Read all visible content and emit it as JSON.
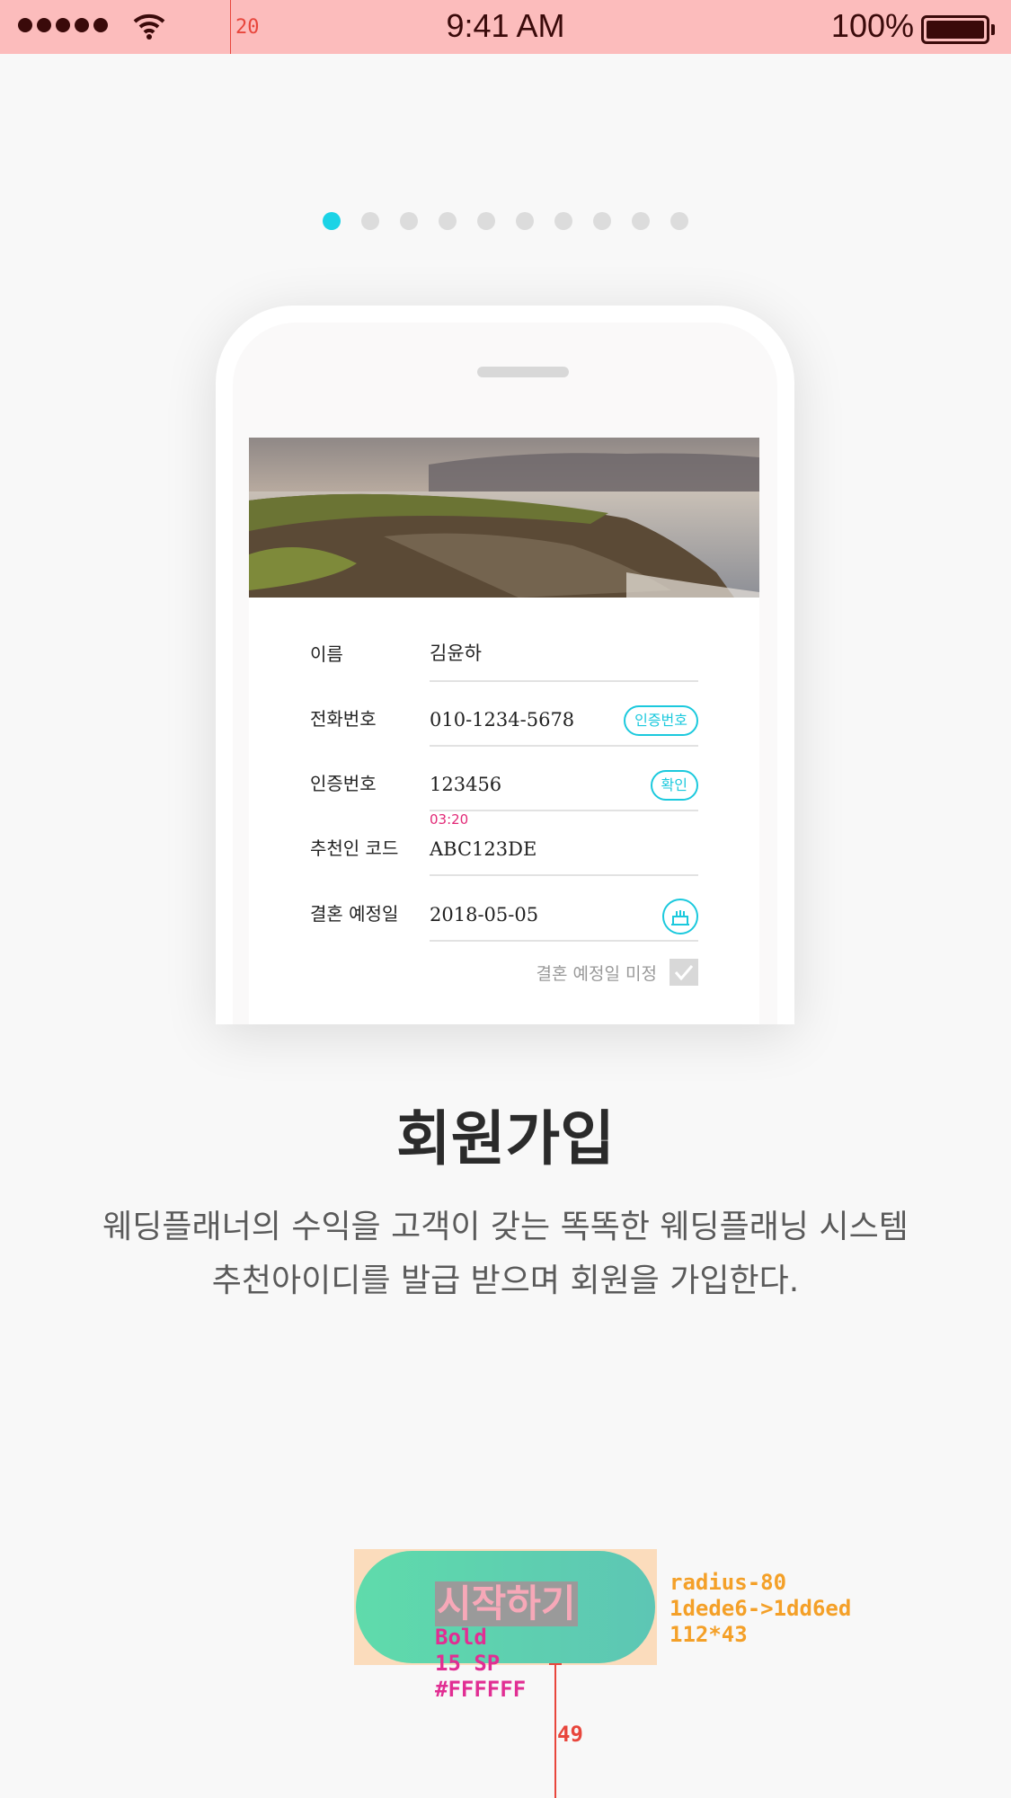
{
  "status_bar": {
    "time": "9:41 AM",
    "battery": "100%",
    "guide_label": "20"
  },
  "pagination": {
    "total": 10,
    "active_index": 0,
    "active_color": "#1bd3e6"
  },
  "form": {
    "name": {
      "label": "이름",
      "value": "김윤하"
    },
    "phone": {
      "label": "전화번호",
      "value": "010-1234-5678",
      "button": "인증번호"
    },
    "verification": {
      "label": "인증번호",
      "value": "123456",
      "button": "확인",
      "timer": "03:20"
    },
    "referral": {
      "label": "추천인 코드",
      "value": "ABC123DE"
    },
    "wedding_date": {
      "label": "결혼 예정일",
      "value": "2018-05-05",
      "icon": "cake-icon"
    },
    "undecided": {
      "label": "결혼 예정일 미정",
      "checked": true
    }
  },
  "title": "회원가입",
  "description": [
    "웨딩플래너의 수익을 고객이 갖는 똑똑한 웨딩플래닝 시스템",
    "추천아이디를 발급 받으며 회원을 가입한다."
  ],
  "cta": {
    "label": "시작하기",
    "gradient": [
      "#5fdbab",
      "#5dc6b4"
    ]
  },
  "annotations": {
    "text_spec": [
      "Bold",
      "15 SP",
      "#FFFFFF"
    ],
    "button_spec": [
      "radius-80",
      "1dede6->1dd6ed",
      "112*43"
    ],
    "spacing": "49"
  },
  "colors": {
    "accent": "#1bc9dd",
    "timer": "#e22977",
    "status_bar": "#fcbcbc"
  }
}
